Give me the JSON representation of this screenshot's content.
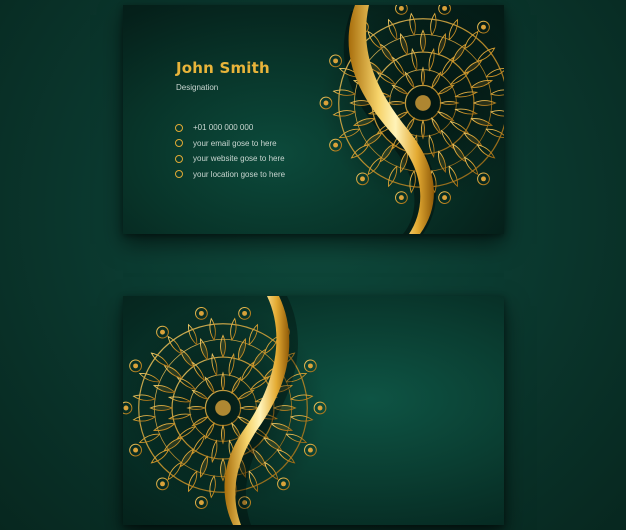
{
  "front_card": {
    "name": "John Smith",
    "designation": "Designation",
    "contacts": [
      {
        "icon": "circle-bullet-icon",
        "text": "+01 000 000 000"
      },
      {
        "icon": "circle-bullet-icon",
        "text": "your email gose to here"
      },
      {
        "icon": "circle-bullet-icon",
        "text": "your website gose to here"
      },
      {
        "icon": "circle-bullet-icon",
        "text": "your location gose to here"
      }
    ]
  },
  "back_card": {},
  "colors": {
    "background": "#0b3a30",
    "card_dark": "#05201a",
    "card_green": "#0c4a3b",
    "gold": "#e8b43a",
    "gold_light": "#ffe89a",
    "gold_dark": "#b27a12",
    "text_light": "#c9d6d1"
  }
}
